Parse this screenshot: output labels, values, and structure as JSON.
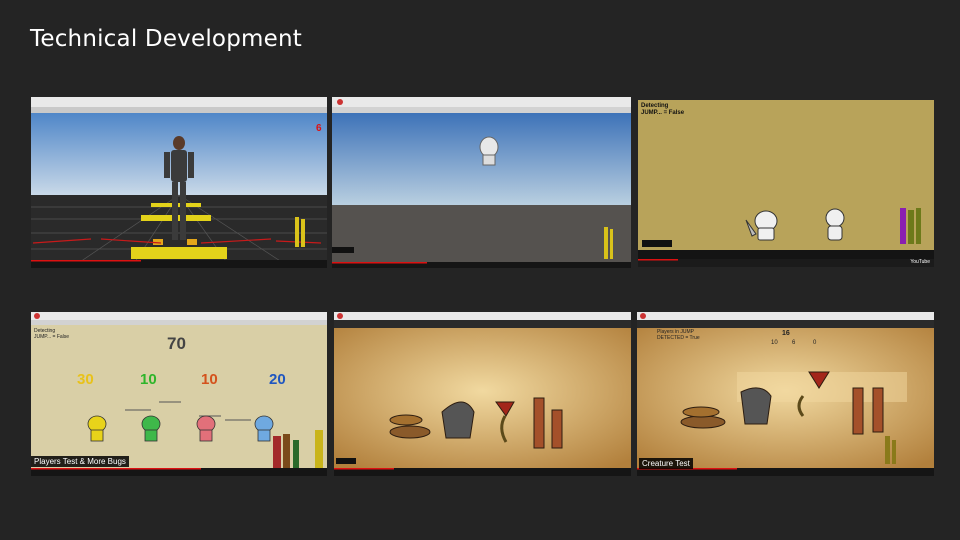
{
  "slide": {
    "title": "Technical Development"
  },
  "videos": [
    {
      "hud_number": "6"
    },
    {
      "caption": ""
    },
    {
      "hud_line1": "Detecting",
      "hud_line2": "JUMP... = False",
      "watermark": "YouTube"
    },
    {
      "hud_line1": "Detecting",
      "hud_line2": "JUMP... = False",
      "score_top": "70",
      "scores": [
        {
          "value": "30",
          "color": "#e8c21a"
        },
        {
          "value": "10",
          "color": "#2fb52a"
        },
        {
          "value": "10",
          "color": "#d4521c"
        },
        {
          "value": "20",
          "color": "#1f56c0"
        }
      ],
      "caption": "Players Test & More Bugs"
    },
    {
      "caption": ""
    },
    {
      "hud_line1": "Players in JUMP",
      "hud_line2": "DETECTED = True",
      "num_top": "16",
      "num_a": "10",
      "num_b": "6",
      "num_c": "0",
      "caption": "Creature Test"
    }
  ]
}
